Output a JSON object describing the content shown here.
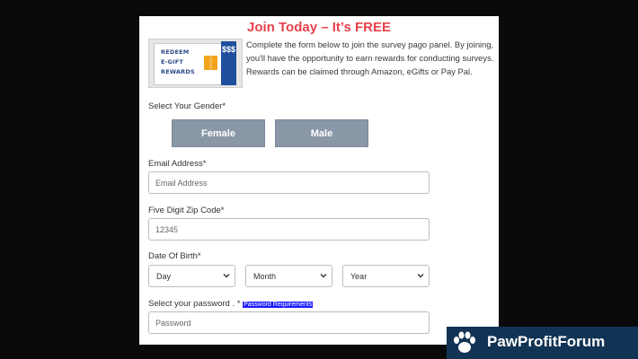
{
  "form": {
    "title": "Join Today – It’s FREE",
    "intro": "Complete the form below to join the survey pago panel. By joining, you'll have the opportunity to earn rewards for conducting surveys. Rewards can be claimed through Amazon, eGifts or Pay Pal.",
    "promo_image": {
      "lines": [
        "REDEEM",
        "E-GIFT",
        "REWARDS"
      ],
      "stub_text": "$$$",
      "icon": "gift-card-icon"
    },
    "gender": {
      "label": "Select Your Gender*",
      "options": [
        "Female",
        "Male"
      ]
    },
    "email": {
      "label": "Email Address*",
      "placeholder": "Email Address"
    },
    "zip": {
      "label": "Five Digit Zip Code*",
      "placeholder": "12345"
    },
    "dob": {
      "label": "Date Of Birth*",
      "day": "Day",
      "month": "Month",
      "year": "Year"
    },
    "password": {
      "label": "Select your password . *",
      "requirements_link": "Password Requirements",
      "placeholder": "Password"
    }
  },
  "watermark": {
    "text": "PawProfitForum",
    "icon": "paw-icon"
  },
  "colors": {
    "title": "#e8414a",
    "gender_button": "#8a97a7",
    "link_highlight": "#1a1aff",
    "brand_bg": "#123454",
    "page_bg": "#0a0a0a"
  }
}
